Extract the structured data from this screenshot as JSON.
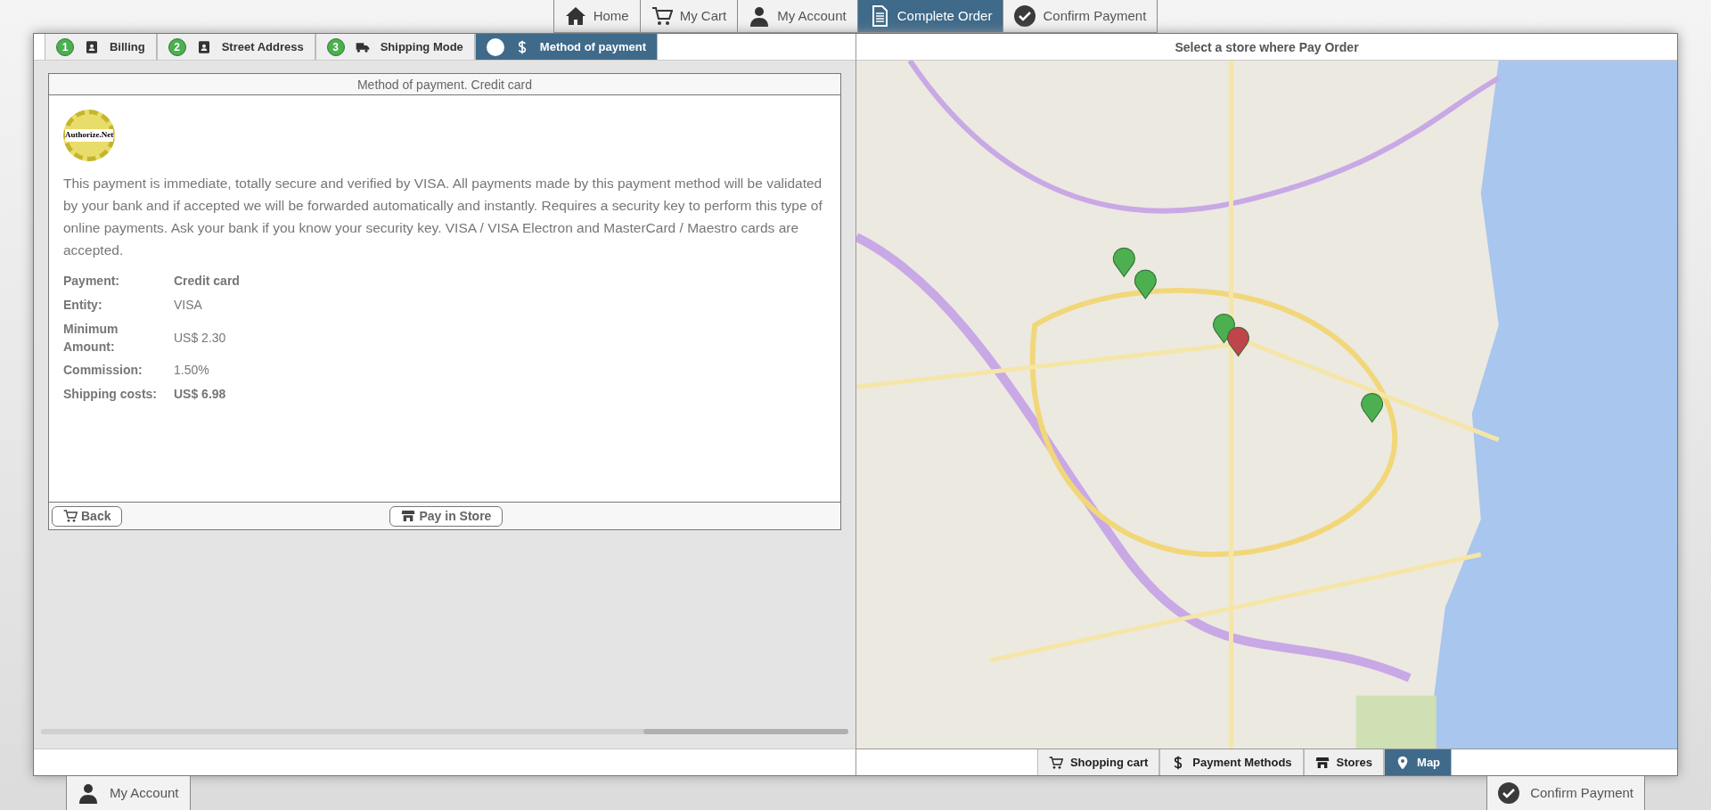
{
  "top_nav": [
    {
      "label": "Home",
      "kind": "home",
      "selected": false
    },
    {
      "label": "My Cart",
      "kind": "cart",
      "selected": false
    },
    {
      "label": "My Account",
      "kind": "user",
      "selected": false
    },
    {
      "label": "Complete Order",
      "kind": "document",
      "selected": true
    },
    {
      "label": "Confirm Payment",
      "kind": "check",
      "selected": false
    }
  ],
  "steps": [
    {
      "number": "1",
      "label": "Billing",
      "kind": "done",
      "selected": false
    },
    {
      "number": "2",
      "label": "Street Address",
      "kind": "done",
      "selected": false
    },
    {
      "number": "3",
      "label": "Shipping Mode",
      "kind": "done",
      "selected": false
    },
    {
      "label": "Method of payment",
      "kind": "current",
      "selected": true
    }
  ],
  "payment_panel": {
    "title": "Method of payment. Credit card",
    "logo": "Authorize.Net",
    "description": "This payment is immediate, totally secure and verified by VISA. All payments made by this payment method will be validated by your bank and if accepted we will be forwarded automatically and instantly. Requires a security key to perform this type of online payments. Ask your bank if you know your security key. VISA / VISA Electron and MasterCard / Maestro cards are accepted.",
    "details": [
      {
        "label": "Payment:",
        "value": "Credit card",
        "emphasized": true
      },
      {
        "label": "Entity:",
        "value": "VISA",
        "emphasized": false
      },
      {
        "label": "Minimum Amount:",
        "value": "US$ 2.30",
        "emphasized": false
      },
      {
        "label": "Commission:",
        "value": "1.50%",
        "emphasized": false
      },
      {
        "label": "Shipping costs:",
        "value": "US$ 6.98",
        "emphasized": true
      }
    ],
    "buttons": [
      {
        "label": "Back",
        "kind": "cart"
      },
      {
        "label": "Pay in Store",
        "kind": "store"
      }
    ]
  },
  "map_panel": {
    "title": "Select a store where Pay Order"
  },
  "map_tabs": [
    {
      "label": "Shopping cart",
      "kind": "cart",
      "selected": false
    },
    {
      "label": "Payment Methods",
      "kind": "dollar",
      "selected": false
    },
    {
      "label": "Stores",
      "kind": "store",
      "selected": false
    },
    {
      "label": "Map",
      "kind": "pin",
      "selected": true
    }
  ],
  "bottom_nav": [
    {
      "label": "My Account",
      "kind": "user"
    },
    {
      "label": "Confirm Payment",
      "kind": "check"
    }
  ]
}
